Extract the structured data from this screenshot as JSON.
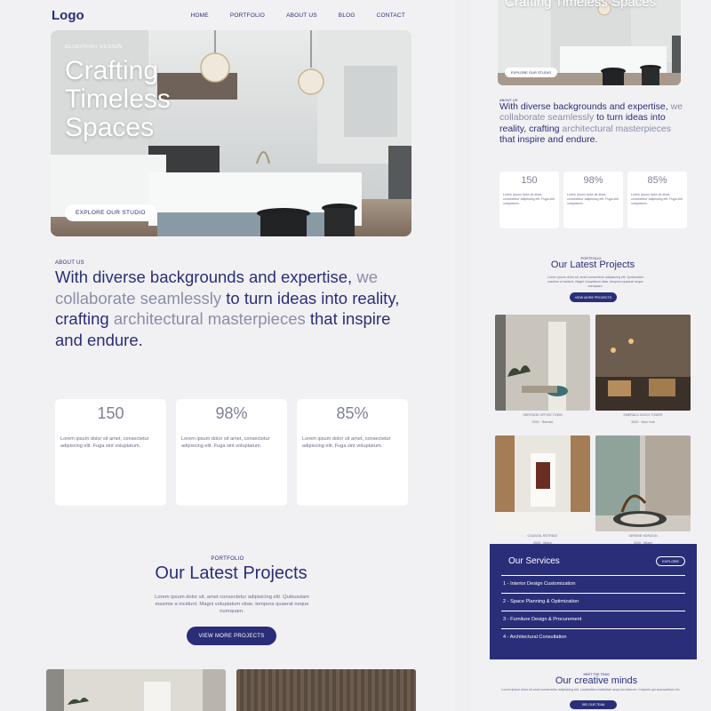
{
  "nav": {
    "logo": "Logo",
    "items": [
      "HOME",
      "PORTFOLIO",
      "ABOUT US",
      "BLOG",
      "CONTACT"
    ]
  },
  "hero": {
    "eyebrow": "BLUEPRINT DESIGN",
    "title": "Crafting Timeless Spaces",
    "button": "EXPLORE OUR STUDIO"
  },
  "about": {
    "tag": "ABOUT US",
    "seg1": "With diverse backgrounds and expertise, ",
    "seg2": "we collaborate seamlessly",
    "seg3": " to turn ideas into reality, crafting ",
    "seg4": "architectural masterpieces",
    "seg5": " that inspire and endure."
  },
  "stats": [
    {
      "value": "150",
      "text": "Lorem ipsum dolor sit amet, consectetur adipiscing elit. Fuga sint voluptatum."
    },
    {
      "value": "98%",
      "text": "Lorem ipsum dolor sit amet, consectetur adipiscing elit. Fuga sint voluptatum."
    },
    {
      "value": "85%",
      "text": "Lorem ipsum dolor sit amet, consectetur adipiscing elit. Fuga sint voluptatum."
    }
  ],
  "portfolio": {
    "tag": "PORTFOLIO",
    "title": "Our Latest Projects",
    "desc": "Lorem ipsum dolor sit, amet consectetur adipisicing elit. Quibusdam maxime a incidunt. Magni voluptatum vitae, tempora quaerat neque numquam.",
    "button": "VIEW MORE PROJECTS"
  },
  "projects": [
    {
      "title": "HERITAGE OFFICE TOWN",
      "meta": "2020 · Remote"
    },
    {
      "title": "EMERALD DISCO TOWER",
      "meta": "2020 · New York"
    },
    {
      "title": "COASTAL RETREAT",
      "meta": "2020 · Miami"
    },
    {
      "title": "SERENE HORIZON",
      "meta": "2020 · Miami"
    }
  ],
  "services": {
    "title": "Our Services",
    "button": "EXPLORE",
    "items": [
      "1 - Interior Design Customization",
      "2 - Space Planning & Optimization",
      "3 - Furniture Design & Procurement",
      "4 - Architectural Consultation"
    ]
  },
  "team": {
    "tag": "MEET THE TEAM",
    "title": "Our creative minds",
    "desc": "Lorem ipsum dolor sit amet consectetur adipisicing elit. Laudantium molestiae sequi ad dolorum. Corporis qui accusantium hic.",
    "button": "SEE OUR TEAM"
  },
  "colors": {
    "brand": "#2a2e78",
    "muted": "#8b8da6",
    "background": "#eeeff3"
  }
}
